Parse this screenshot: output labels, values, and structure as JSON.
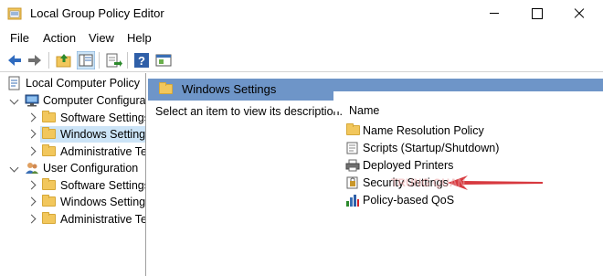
{
  "window": {
    "title": "Local Group Policy Editor"
  },
  "menu": [
    "File",
    "Action",
    "View",
    "Help"
  ],
  "toolbar": {
    "icons": [
      "back-arrow-icon",
      "forward-arrow-icon",
      "up-folder-icon",
      "show-hide-tree-icon",
      "export-list-icon",
      "help-icon",
      "properties-icon"
    ]
  },
  "tree": {
    "root": "Local Computer Policy",
    "computer_config": "Computer Configura",
    "cc_children": [
      "Software Settings",
      "Windows Setting",
      "Administrative Te"
    ],
    "user_config": "User Configuration",
    "uc_children": [
      "Software Settings",
      "Windows Setting",
      "Administrative Te"
    ]
  },
  "right_pane": {
    "header_title": "Windows Settings",
    "description": "Select an item to view its description.",
    "column_name": "Name",
    "items": [
      {
        "label": "Name Resolution Policy",
        "icon": "folder-icon"
      },
      {
        "label": "Scripts (Startup/Shutdown)",
        "icon": "scripts-icon"
      },
      {
        "label": "Deployed Printers",
        "icon": "printer-icon"
      },
      {
        "label": "Security Settings",
        "icon": "security-settings-icon"
      },
      {
        "label": "Policy-based QoS",
        "icon": "bar-chart-icon"
      }
    ]
  },
  "colors": {
    "header_band": "#6e95c8",
    "selection": "#cce4f7",
    "folder": "#f2c75c",
    "annotation_arrow": "#d3242a"
  }
}
